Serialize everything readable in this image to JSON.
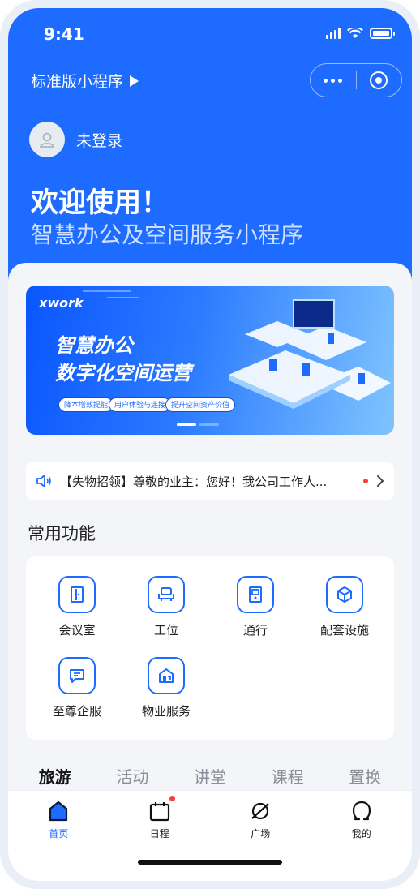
{
  "status_bar": {
    "time": "9:41"
  },
  "header": {
    "mini_program_title": "标准版小程序",
    "menu_icon": "more-dots-icon",
    "close_icon": "target-icon"
  },
  "user": {
    "name": "未登录"
  },
  "welcome": {
    "title": "欢迎使用！",
    "subtitle": "智慧办公及空间服务小程序"
  },
  "banner": {
    "brand": "xwork",
    "slogan_line1": "智慧办公",
    "slogan_line2": "数字化空间运营",
    "tags": [
      "降本增效提能",
      "用户体验与连接",
      "提升空间资产价值"
    ]
  },
  "notice": {
    "text": "【失物招领】尊敬的业主：您好！我公司工作人..."
  },
  "common_functions": {
    "title": "常用功能",
    "items": [
      {
        "label": "会议室",
        "icon": "meeting-room-icon"
      },
      {
        "label": "工位",
        "icon": "workstation-icon"
      },
      {
        "label": "通行",
        "icon": "access-icon"
      },
      {
        "label": "配套设施",
        "icon": "facilities-icon"
      },
      {
        "label": "至尊企服",
        "icon": "enterprise-service-icon"
      },
      {
        "label": "物业服务",
        "icon": "property-service-icon"
      }
    ]
  },
  "category_tabs": [
    "旅游",
    "活动",
    "讲堂",
    "课程",
    "置换"
  ],
  "tabbar": {
    "items": [
      {
        "label": "首页",
        "icon": "home-icon",
        "active": true
      },
      {
        "label": "日程",
        "icon": "calendar-icon",
        "badge": true
      },
      {
        "label": "广场",
        "icon": "planet-icon"
      },
      {
        "label": "我的",
        "icon": "profile-icon"
      }
    ]
  },
  "colors": {
    "primary": "#1e6bff",
    "badge": "#ff3b3b",
    "background": "#f3f5f9"
  }
}
